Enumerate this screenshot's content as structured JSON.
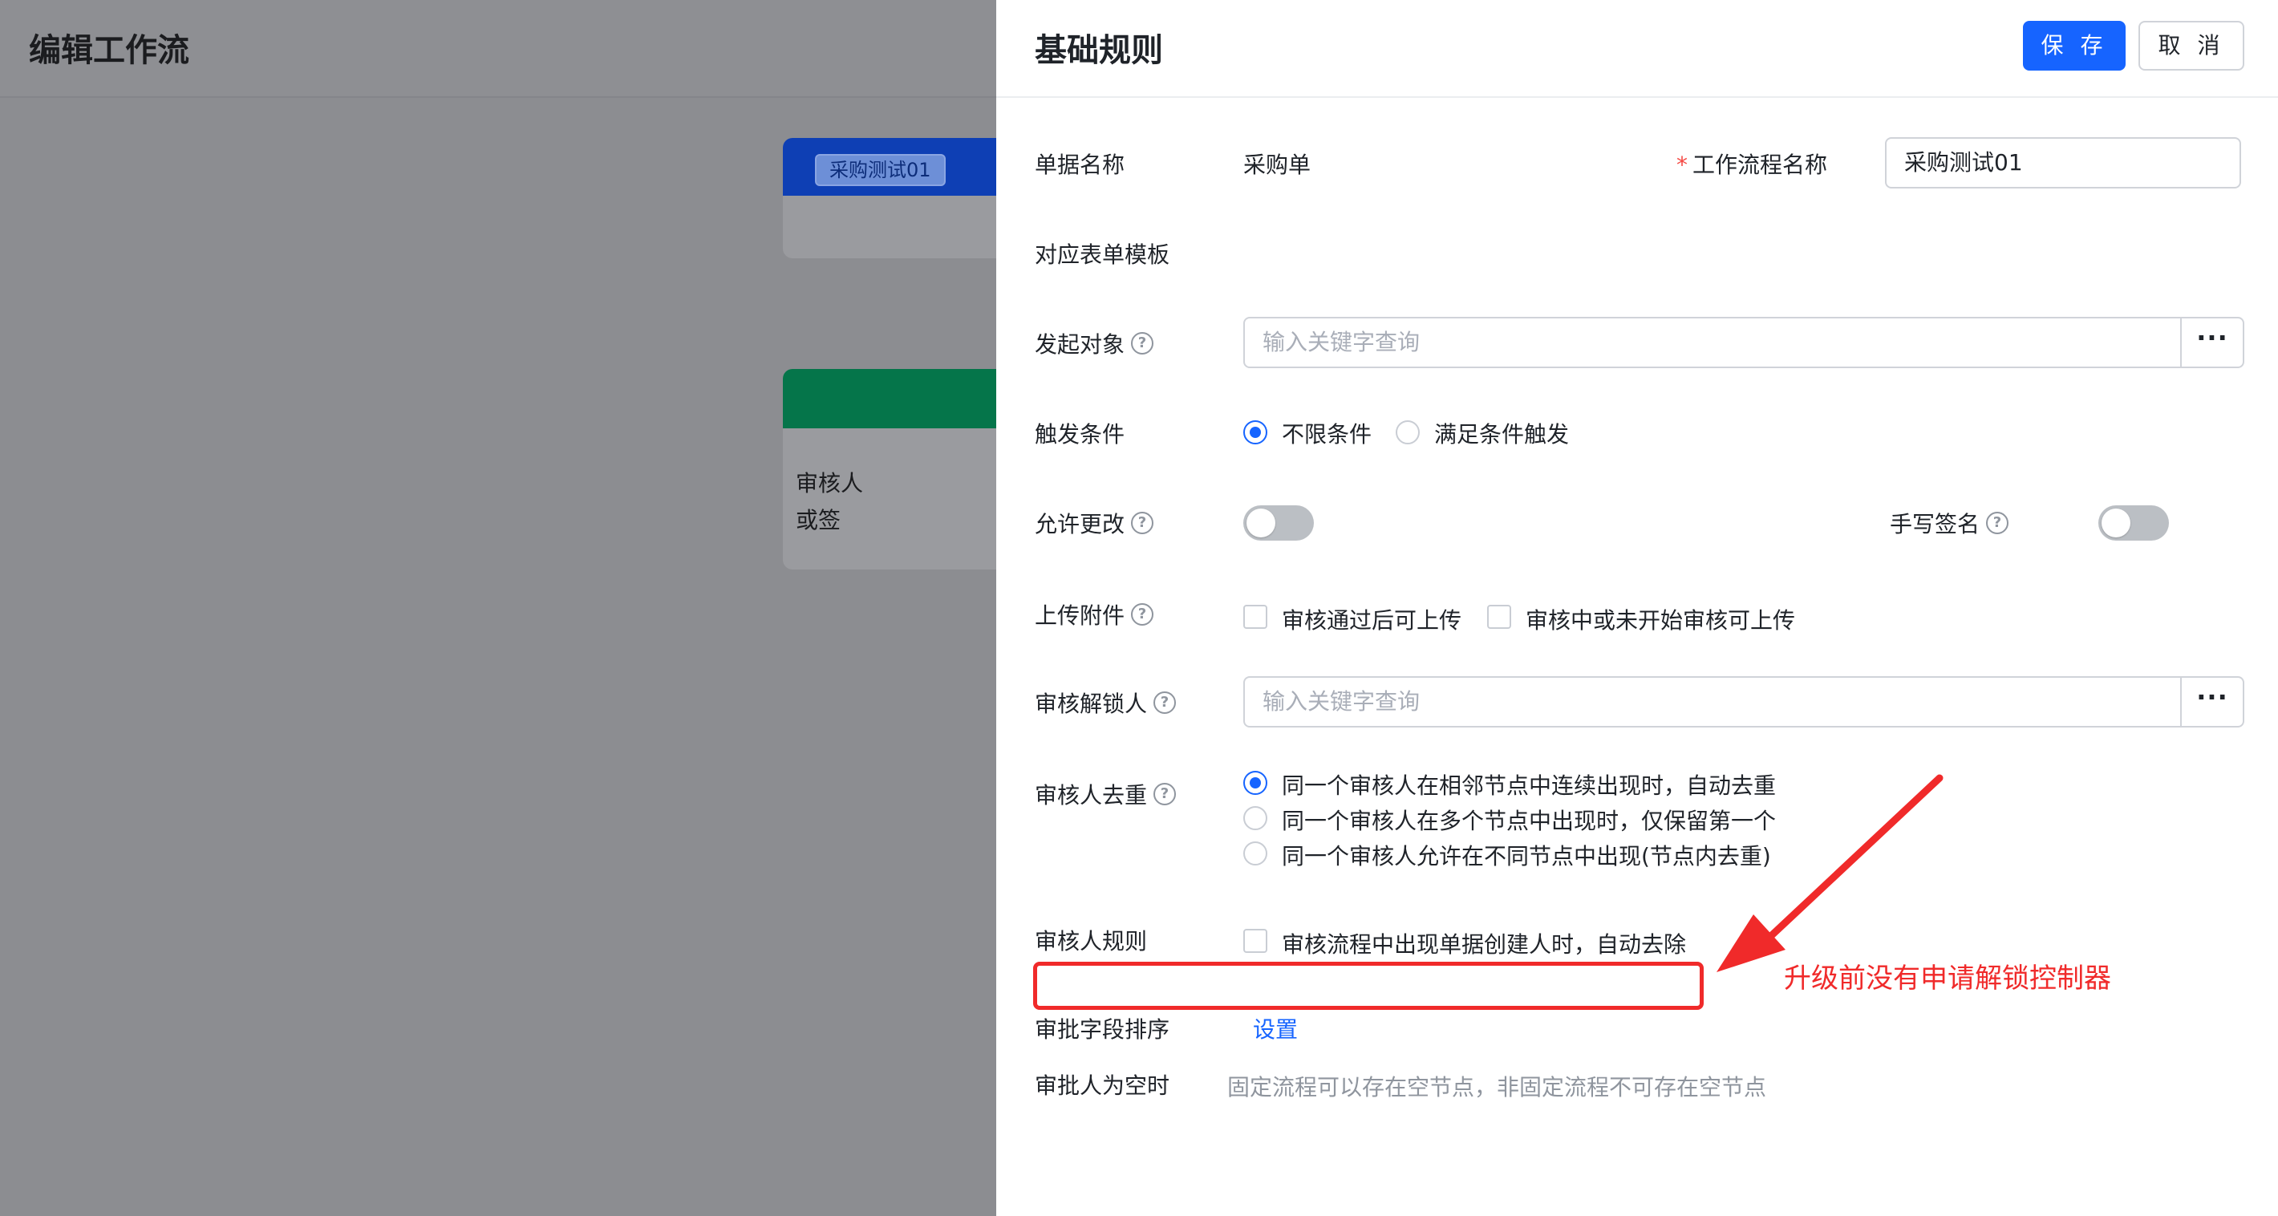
{
  "background": {
    "title": "编辑工作流",
    "card1_tag": "采购测试01",
    "card2_lines": [
      "审核人",
      "或签"
    ]
  },
  "drawer": {
    "title": "基础规则",
    "save_label": "保 存",
    "cancel_label": "取 消"
  },
  "form": {
    "doc_name_label": "单据名称",
    "doc_name_value": "采购单",
    "workflow_name_required": "*",
    "workflow_name_label": "工作流程名称",
    "workflow_name_value": "采购测试01",
    "form_template_label": "对应表单模板",
    "initiator_label": "发起对象",
    "initiator_placeholder": "输入关键字查询",
    "trigger_label": "触发条件",
    "trigger_options": [
      "不限条件",
      "满足条件触发"
    ],
    "trigger_selected": "不限条件",
    "allow_change_label": "允许更改",
    "allow_change_on": false,
    "signature_label": "手写签名",
    "signature_on": false,
    "upload_label": "上传附件",
    "upload_options": [
      "审核通过后可上传",
      "审核中或未开始审核可上传"
    ],
    "unlocker_label": "审核解锁人",
    "unlocker_placeholder": "输入关键字查询",
    "dedupe_label": "审核人去重",
    "dedupe_options": [
      "同一个审核人在相邻节点中连续出现时，自动去重",
      "同一个审核人在多个节点中出现时，仅保留第一个",
      "同一个审核人允许在不同节点中出现(节点内去重)"
    ],
    "dedupe_selected": "同一个审核人在相邻节点中连续出现时，自动去重",
    "reviewer_rule_label": "审核人规则",
    "reviewer_rule_option": "审核流程中出现单据创建人时，自动去除",
    "field_sort_label": "审批字段排序",
    "field_sort_link": "设置",
    "empty_approver_label": "审批人为空时",
    "empty_approver_hint": "固定流程可以存在空节点，非固定流程不可存在空节点"
  },
  "annotation": {
    "text": "升级前没有申请解锁控制器",
    "color": "#f02a2a"
  },
  "colors": {
    "primary": "#1664ff",
    "annotation": "#f02a2a",
    "overlay": "#8c8d91"
  },
  "icons": {
    "help": "question-circle-icon",
    "more": "more-dots-icon"
  }
}
